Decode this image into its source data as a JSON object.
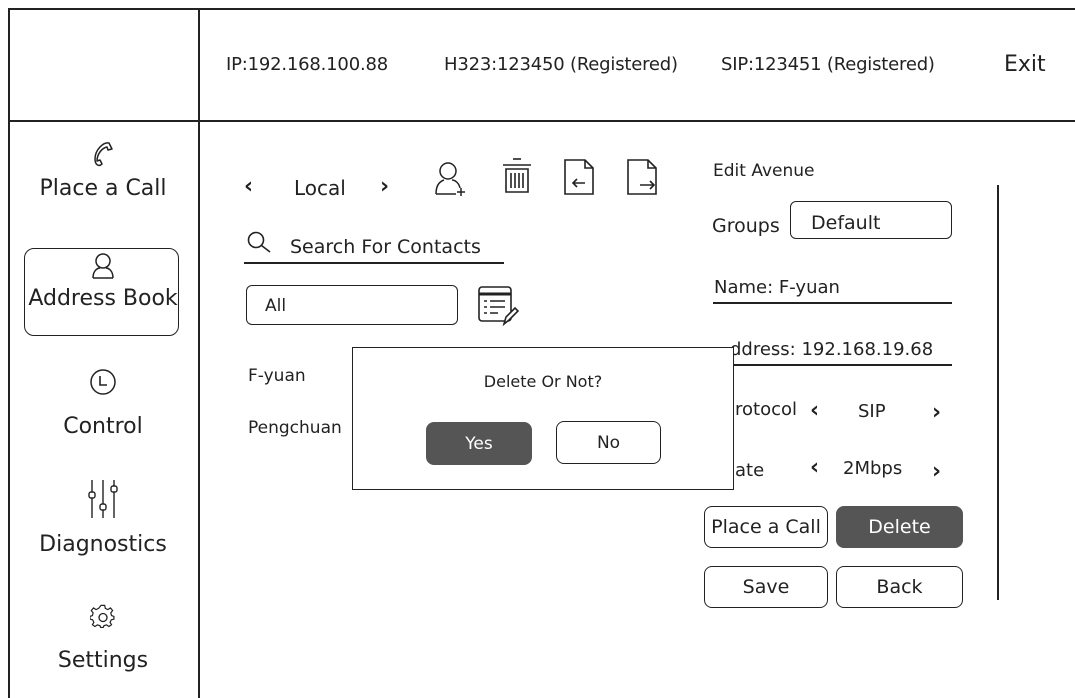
{
  "status_bar": {
    "ip": "IP:192.168.100.88",
    "h323": "H323:123450 (Registered)",
    "sip": "SIP:123451 (Registered)",
    "exit": "Exit"
  },
  "sidebar": {
    "items": [
      {
        "label": "Place a Call",
        "icon": "phone-icon"
      },
      {
        "label": "Address Book",
        "icon": "person-icon"
      },
      {
        "label": "Control",
        "icon": "clock-icon"
      },
      {
        "label": "Diagnostics",
        "icon": "sliders-icon"
      },
      {
        "label": "Settings",
        "icon": "gear-icon"
      }
    ]
  },
  "toolbar": {
    "source_label": "Local",
    "icons": [
      "add-contact-icon",
      "trash-icon",
      "import-icon",
      "export-icon"
    ]
  },
  "search": {
    "placeholder": "Search For Contacts"
  },
  "filter": {
    "value": "All",
    "icon": "list-edit-icon"
  },
  "contacts": [
    "F-yuan",
    "Pengchuan"
  ],
  "dialog": {
    "title": "Delete Or Not?",
    "yes": "Yes",
    "no": "No"
  },
  "edit_panel": {
    "title": "Edit Avenue",
    "groups_label": "Groups",
    "groups_value": "Default",
    "name": "Name: F-yuan",
    "address_visible": "ddress: 192.168.19.68",
    "protocol_label_visible": "rotocol",
    "protocol_value": "SIP",
    "rate_label_visible": "ate",
    "rate_value": "2Mbps",
    "place_call": "Place a Call",
    "delete": "Delete",
    "save": "Save",
    "back": "Back"
  },
  "colors": {
    "accent": "#555555",
    "line": "#222222"
  }
}
